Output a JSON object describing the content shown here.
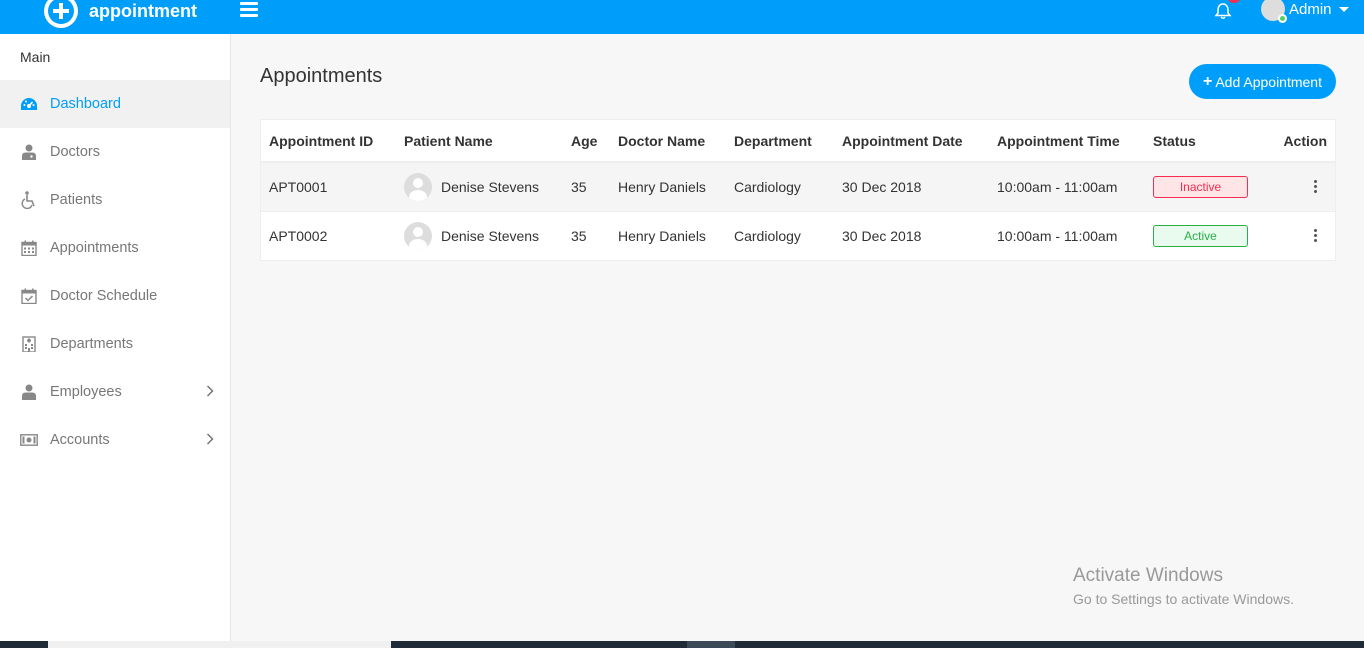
{
  "header": {
    "brand_name": "appointment",
    "user_name": "Admin",
    "accent_color": "#009efb",
    "icons": [
      "logo-cross-icon",
      "hamburger-icon",
      "bell-icon",
      "user-avatar-icon",
      "caret-down-icon"
    ]
  },
  "sidebar": {
    "section_title": "Main",
    "items": [
      {
        "label": "Dashboard",
        "icon": "dashboard-icon",
        "active": true
      },
      {
        "label": "Doctors",
        "icon": "doctor-icon"
      },
      {
        "label": "Patients",
        "icon": "wheelchair-icon"
      },
      {
        "label": "Appointments",
        "icon": "calendar-icon"
      },
      {
        "label": "Doctor Schedule",
        "icon": "calendar-check-icon"
      },
      {
        "label": "Departments",
        "icon": "hospital-icon"
      },
      {
        "label": "Employees",
        "icon": "user-icon",
        "has_submenu": true
      },
      {
        "label": "Accounts",
        "icon": "money-icon",
        "has_submenu": true
      }
    ]
  },
  "main": {
    "title": "Appointments",
    "add_button_label": "Add Appointment",
    "table": {
      "headers": [
        "Appointment ID",
        "Patient Name",
        "Age",
        "Doctor Name",
        "Department",
        "Appointment Date",
        "Appointment Time",
        "Status",
        "Action"
      ],
      "rows": [
        {
          "id": "APT0001",
          "patient": "Denise Stevens",
          "age": "35",
          "doctor": "Henry Daniels",
          "department": "Cardiology",
          "date": "30 Dec 2018",
          "time": "10:00am - 11:00am",
          "status": "Inactive"
        },
        {
          "id": "APT0002",
          "patient": "Denise Stevens",
          "age": "35",
          "doctor": "Henry Daniels",
          "department": "Cardiology",
          "date": "30 Dec 2018",
          "time": "10:00am - 11:00am",
          "status": "Active"
        }
      ]
    }
  },
  "watermark": {
    "line1": "Activate Windows",
    "line2": "Go to Settings to activate Windows."
  }
}
